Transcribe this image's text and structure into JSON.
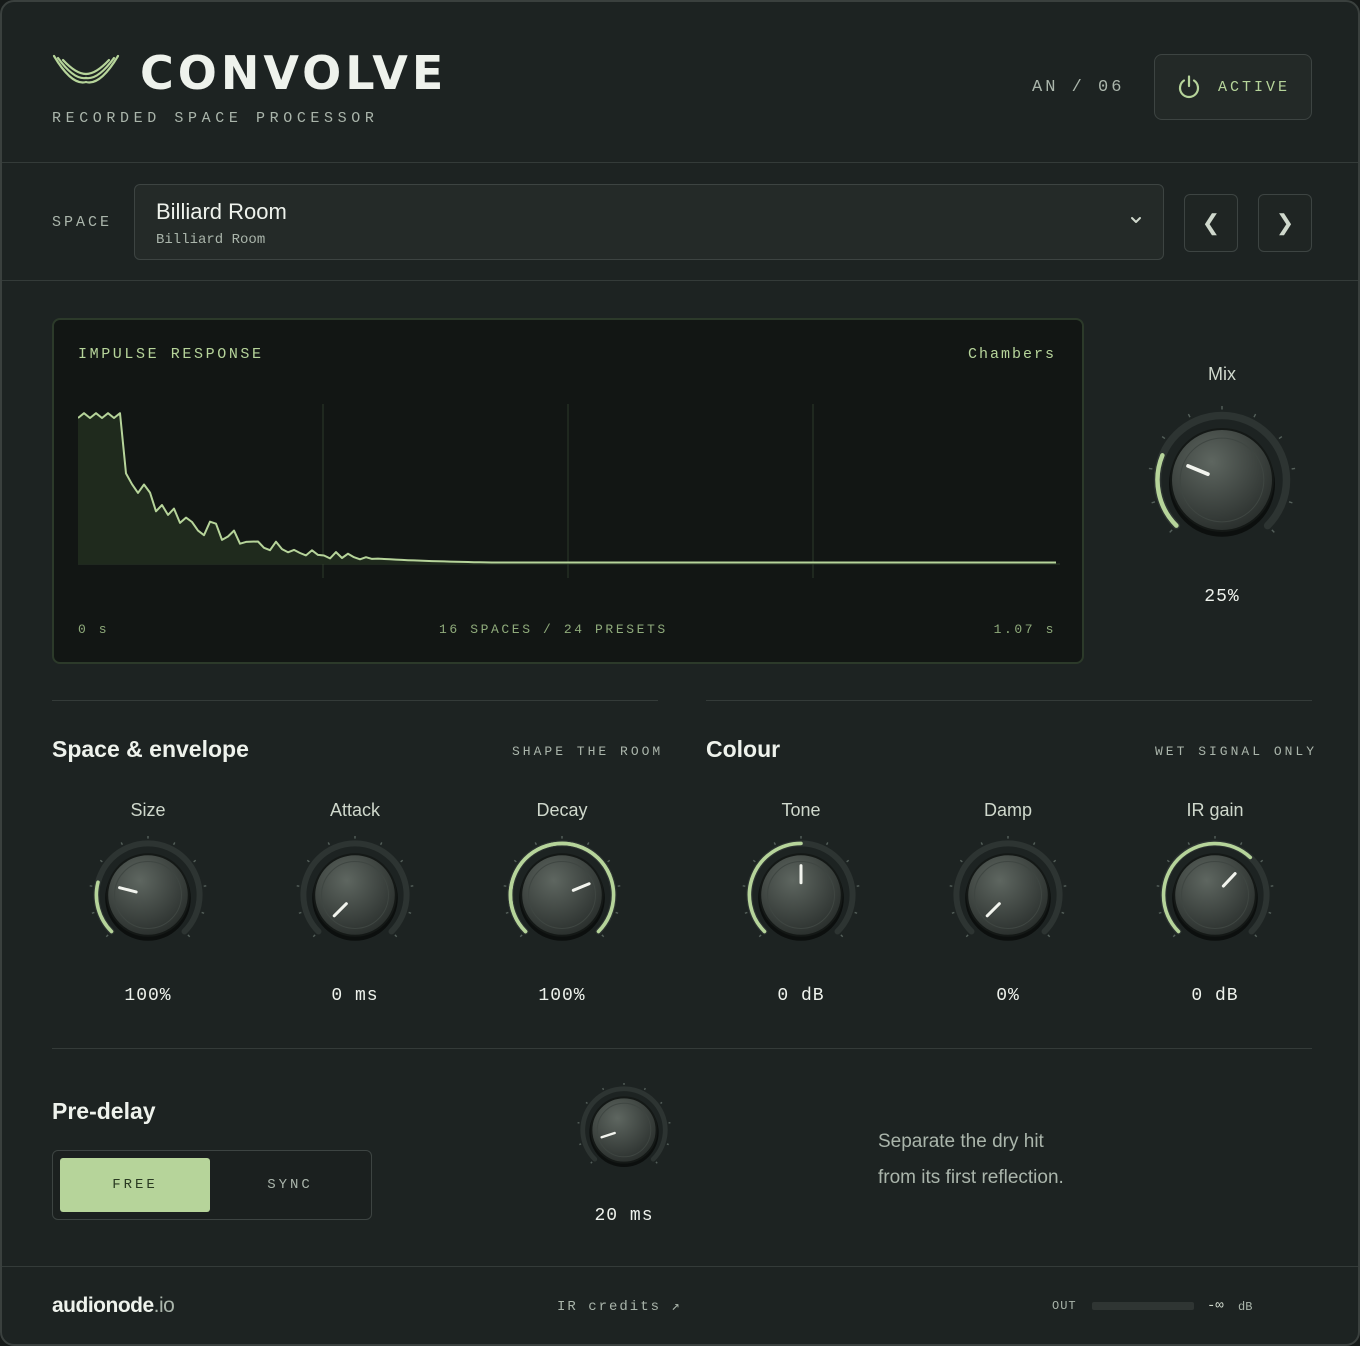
{
  "header": {
    "brand": "CONVOLVE",
    "tagline": "RECORDED SPACE PROCESSOR",
    "version": "AN / 06",
    "active_label": "ACTIVE"
  },
  "space": {
    "label": "SPACE",
    "selected_title": "Billiard Room",
    "selected_subtitle": "Billiard Room",
    "prev_glyph": "❮",
    "next_glyph": "❯"
  },
  "impulse": {
    "title": "IMPULSE RESPONSE",
    "category": "Chambers",
    "start_time": "0 s",
    "summary": "16 SPACES / 24 PRESETS",
    "end_time": "1.07 s"
  },
  "mix": {
    "label": "Mix",
    "value": "25%",
    "level": 0.25
  },
  "space_envelope": {
    "title": "Space & envelope",
    "tag": "SHAPE THE ROOM",
    "knobs": [
      {
        "label": "Size",
        "value": "100%",
        "level": 0.25,
        "arc": "left"
      },
      {
        "label": "Attack",
        "value": "0 ms",
        "level": 0.0,
        "arc": "none"
      },
      {
        "label": "Decay",
        "value": "100%",
        "level": 0.75,
        "arc": "full"
      }
    ]
  },
  "colour": {
    "title": "Colour",
    "tag": "WET SIGNAL ONLY",
    "knobs": [
      {
        "label": "Tone",
        "value": "0 dB",
        "level": 0.5,
        "arc": "left"
      },
      {
        "label": "Damp",
        "value": "0%",
        "level": 0.0,
        "arc": "none"
      },
      {
        "label": "IR gain",
        "value": "0 dB",
        "level": 0.66,
        "arc": "left"
      }
    ]
  },
  "predelay": {
    "title": "Pre-delay",
    "mode_free": "FREE",
    "mode_sync": "SYNC",
    "value": "20 ms",
    "level": 0.1,
    "description_line1": "Separate the dry hit",
    "description_line2": "from its first reflection."
  },
  "footer": {
    "brand_bold": "audionode",
    "brand_tld": ".io",
    "credits": "IR credits ↗",
    "out_label": "OUT",
    "out_value": "-∞",
    "out_unit": "dB"
  },
  "colors": {
    "accent": "#b6d49a",
    "background": "#1d2322",
    "panel": "#121614"
  }
}
